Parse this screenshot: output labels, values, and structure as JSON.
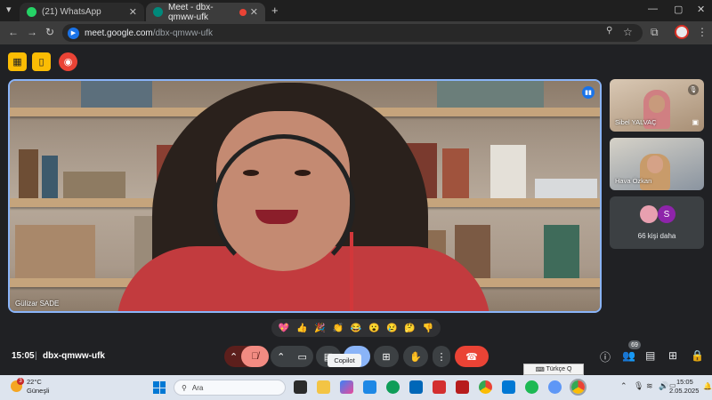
{
  "browser": {
    "tabs": [
      {
        "label": "(21) WhatsApp",
        "active": false
      },
      {
        "label": "Meet - dbx-qmww-ufk",
        "active": true
      }
    ],
    "new_tab_icon": "plus-icon",
    "url_host": "meet.google.com",
    "url_path": "/dbx-qmww-ufk"
  },
  "meeting": {
    "main_speaker_name": "Gülizar SADE",
    "participants": [
      {
        "name": "Sibel YALVAÇ"
      },
      {
        "name": "Hava Özkan"
      }
    ],
    "more_participants": {
      "label": "66 kişi daha",
      "avatar_letter": "S"
    },
    "reactions": [
      "💖",
      "👍",
      "🎉",
      "👏",
      "😂",
      "😮",
      "😢",
      "🤔",
      "👎"
    ],
    "clock": "15:05",
    "separator": "|",
    "code": "dbx-qmww-ufk",
    "tooltip": "Copilot",
    "people_count": "69",
    "colors": {
      "accent": "#8ab4f8",
      "hangup": "#ea4335",
      "mic_off": "#f28b82"
    }
  },
  "ime": {
    "label": "Türkçe Q"
  },
  "taskbar": {
    "weather_temp": "22°C",
    "weather_desc": "Güneşli",
    "weather_badge": "3",
    "search_placeholder": "Ara",
    "time": "15:05",
    "date": "2.05.2025"
  }
}
